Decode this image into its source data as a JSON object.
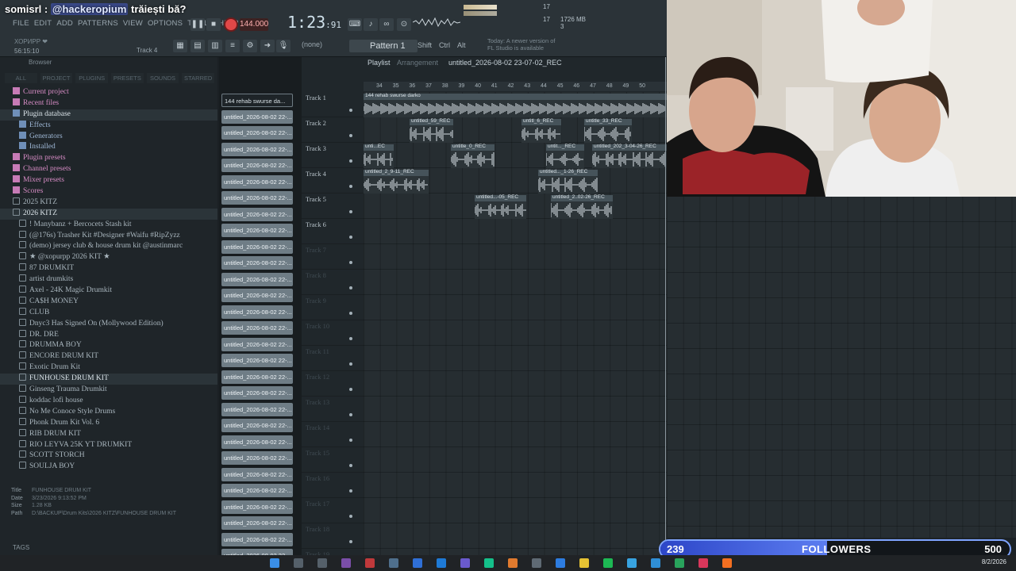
{
  "chat": {
    "user": "somisrl :",
    "mention": "@hackeropium",
    "message": "trăiești bă?"
  },
  "menu": [
    "FILE",
    "EDIT",
    "ADD",
    "PATTERNS",
    "VIEW",
    "OPTIONS",
    "TOOLS",
    "HELP"
  ],
  "transport": {
    "tempo": "144.000",
    "song_time": "1:23",
    "song_time_frac": ":91",
    "pattern": "Pattern 1",
    "snap": "(none)"
  },
  "status": {
    "hint": "ХОРИРР ❤",
    "time": "56:15:10",
    "track_hint": "Track 4",
    "cpu": "17",
    "mem": "1726 MB",
    "mem_b": "1726 MB",
    "voices": "3"
  },
  "news": "Today: A newer version of FL Studio is available",
  "modifiers": [
    "Shift",
    "Ctrl",
    "Alt"
  ],
  "browser": {
    "title": "Browser",
    "tabs": [
      "ALL",
      "PROJECT",
      "PLUGINS",
      "PRESETS",
      "SOUNDS",
      "STARRED"
    ],
    "items": [
      {
        "label": "Current project",
        "style": "pink"
      },
      {
        "label": "Recent files",
        "style": "pink"
      },
      {
        "label": "Plugin database",
        "style": "blue",
        "selected": true
      },
      {
        "label": "Effects",
        "style": "blue",
        "indent": 1
      },
      {
        "label": "Generators",
        "style": "blue",
        "indent": 1
      },
      {
        "label": "Installed",
        "style": "blue",
        "indent": 1
      },
      {
        "label": "Plugin presets",
        "style": "pink"
      },
      {
        "label": "Channel presets",
        "style": "pink"
      },
      {
        "label": "Mixer presets",
        "style": "pink"
      },
      {
        "label": "Scores",
        "style": "pink"
      },
      {
        "label": "2025 KITZ",
        "style": "folder"
      },
      {
        "label": "2026 KITZ",
        "style": "folder",
        "selected": true
      },
      {
        "label": "! Manybanz + Bercocets Stash kit",
        "style": "folder",
        "indent": 1
      },
      {
        "label": "(@176s) Trasher Kit #Designer #Waifu #RipZyzz",
        "style": "folder",
        "indent": 1
      },
      {
        "label": "(demo) jersey club & house drum kit @austinmarc",
        "style": "folder",
        "indent": 1
      },
      {
        "label": "★ @xopurpp 2026 KIT ★",
        "style": "folder",
        "indent": 1
      },
      {
        "label": "87 DRUMKIT",
        "style": "folder",
        "indent": 1
      },
      {
        "label": "artist drumkits",
        "style": "folder",
        "indent": 1
      },
      {
        "label": "Axel - 24K Magic Drumkit",
        "style": "folder",
        "indent": 1
      },
      {
        "label": "CA$H MONEY",
        "style": "folder",
        "indent": 1
      },
      {
        "label": "CLUB",
        "style": "folder",
        "indent": 1
      },
      {
        "label": "Dnyc3 Has Signed On (Mollywood Edition)",
        "style": "folder",
        "indent": 1
      },
      {
        "label": "DR. DRE",
        "style": "folder",
        "indent": 1
      },
      {
        "label": "DRUMMA BOY",
        "style": "folder",
        "indent": 1
      },
      {
        "label": "ENCORE DRUM KIT",
        "style": "folder",
        "indent": 1
      },
      {
        "label": "Exotic Drum Kit",
        "style": "folder",
        "indent": 1
      },
      {
        "label": "FUNHOUSE DRUM KIT",
        "style": "folder",
        "indent": 1,
        "selected": true
      },
      {
        "label": "Ginseng Trauma Drumkit",
        "style": "folder",
        "indent": 1
      },
      {
        "label": "koddac lofi house",
        "style": "folder",
        "indent": 1
      },
      {
        "label": "No Me Conoce Style Drums",
        "style": "folder",
        "indent": 1
      },
      {
        "label": "Phonk Drum Kit Vol. 6",
        "style": "folder",
        "indent": 1
      },
      {
        "label": "RIB DRUM KIT",
        "style": "folder",
        "indent": 1
      },
      {
        "label": "RIO LEYVA 25K YT DRUMKIT",
        "style": "folder",
        "indent": 1
      },
      {
        "label": "SCOTT STORCH",
        "style": "folder",
        "indent": 1
      },
      {
        "label": "SOULJA BOY",
        "style": "folder",
        "indent": 1
      }
    ],
    "info": {
      "title_k": "Title",
      "title": "FUNHOUSE DRUM KIT",
      "date_k": "Date",
      "date": "3/23/2026 9:13:52 PM",
      "size_k": "Size",
      "size": "1.28 KB",
      "path_k": "Path",
      "path": "D:\\BACKUP\\Drum Kits\\2026 KITZ\\FUNHOUSE DRUM KIT"
    },
    "tags": "TAGS"
  },
  "channels": [
    "144 rehab swurse da...",
    "untitled_2026-08-02 22-...",
    "untitled_2026-08-02 22-...",
    "untitled_2026-08-02 22-...",
    "untitled_2026-08-02 22-...",
    "untitled_2026-08-02 22-...",
    "untitled_2026-08-02 22-...",
    "untitled_2026-08-02 22-...",
    "untitled_2026-08-02 22-...",
    "untitled_2026-08-02 22-...",
    "untitled_2026-08-02 22-...",
    "untitled_2026-08-02 22-...",
    "untitled_2026-08-02 22-...",
    "untitled_2026-08-02 22-...",
    "untitled_2026-08-02 22-...",
    "untitled_2026-08-02 22-...",
    "untitled_2026-08-02 22-...",
    "untitled_2026-08-02 22-...",
    "untitled_2026-08-02 22-...",
    "untitled_2026-08-02 22-...",
    "untitled_2026-08-02 22-...",
    "untitled_2026-08-02 22-...",
    "untitled_2026-08-02 22-...",
    "untitled_2026-08-02 22-...",
    "untitled_2026-08-02 22-...",
    "untitled_2026-08-02 22-...",
    "untitled_2026-08-02 22-...",
    "untitled_2026-08-02 22-...",
    "untitled_2026-08-02 22-..."
  ],
  "playlist": {
    "title": "Playlist",
    "mode": "Arrangement",
    "project": "untitled_2026-08-02 23-07-02_REC",
    "bars": [
      "34",
      "35",
      "36",
      "37",
      "38",
      "39",
      "40",
      "41",
      "42",
      "43",
      "44",
      "45",
      "46",
      "47",
      "48",
      "49",
      "50"
    ],
    "tracks": [
      "Track 1",
      "Track 2",
      "Track 3",
      "Track 4",
      "Track 5",
      "Track 6",
      "Track 7",
      "Track 8",
      "Track 9",
      "Track 10",
      "Track 11",
      "Track 12",
      "Track 13",
      "Track 14",
      "Track 15",
      "Track 16",
      "Track 17",
      "Track 18",
      "Track 19"
    ],
    "clips": [
      {
        "track": 1,
        "label": "144 rehab swurse darko"
      },
      {
        "track": 2,
        "label": "untitled_59_REC"
      },
      {
        "track": 2,
        "label": "untitl_6_REC"
      },
      {
        "track": 2,
        "label": "untitle_33_REC"
      },
      {
        "track": 3,
        "label": "unti...EC"
      },
      {
        "track": 3,
        "label": "untitle_0_REC"
      },
      {
        "track": 3,
        "label": "untit..._REC"
      },
      {
        "track": 3,
        "label": "untitled_202_3-04-26_REC"
      },
      {
        "track": 4,
        "label": "untitled_2_9-11_REC"
      },
      {
        "track": 4,
        "label": "untitled..._1-26_REC"
      },
      {
        "track": 5,
        "label": "untitled...-05_REC"
      },
      {
        "track": 5,
        "label": "untitled_2..02-26_REC"
      }
    ]
  },
  "followers": {
    "current": "239",
    "label": "FOLLOWERS",
    "goal": "500",
    "progress": 0.478
  },
  "taskbar": {
    "date": "8/2/2026"
  }
}
